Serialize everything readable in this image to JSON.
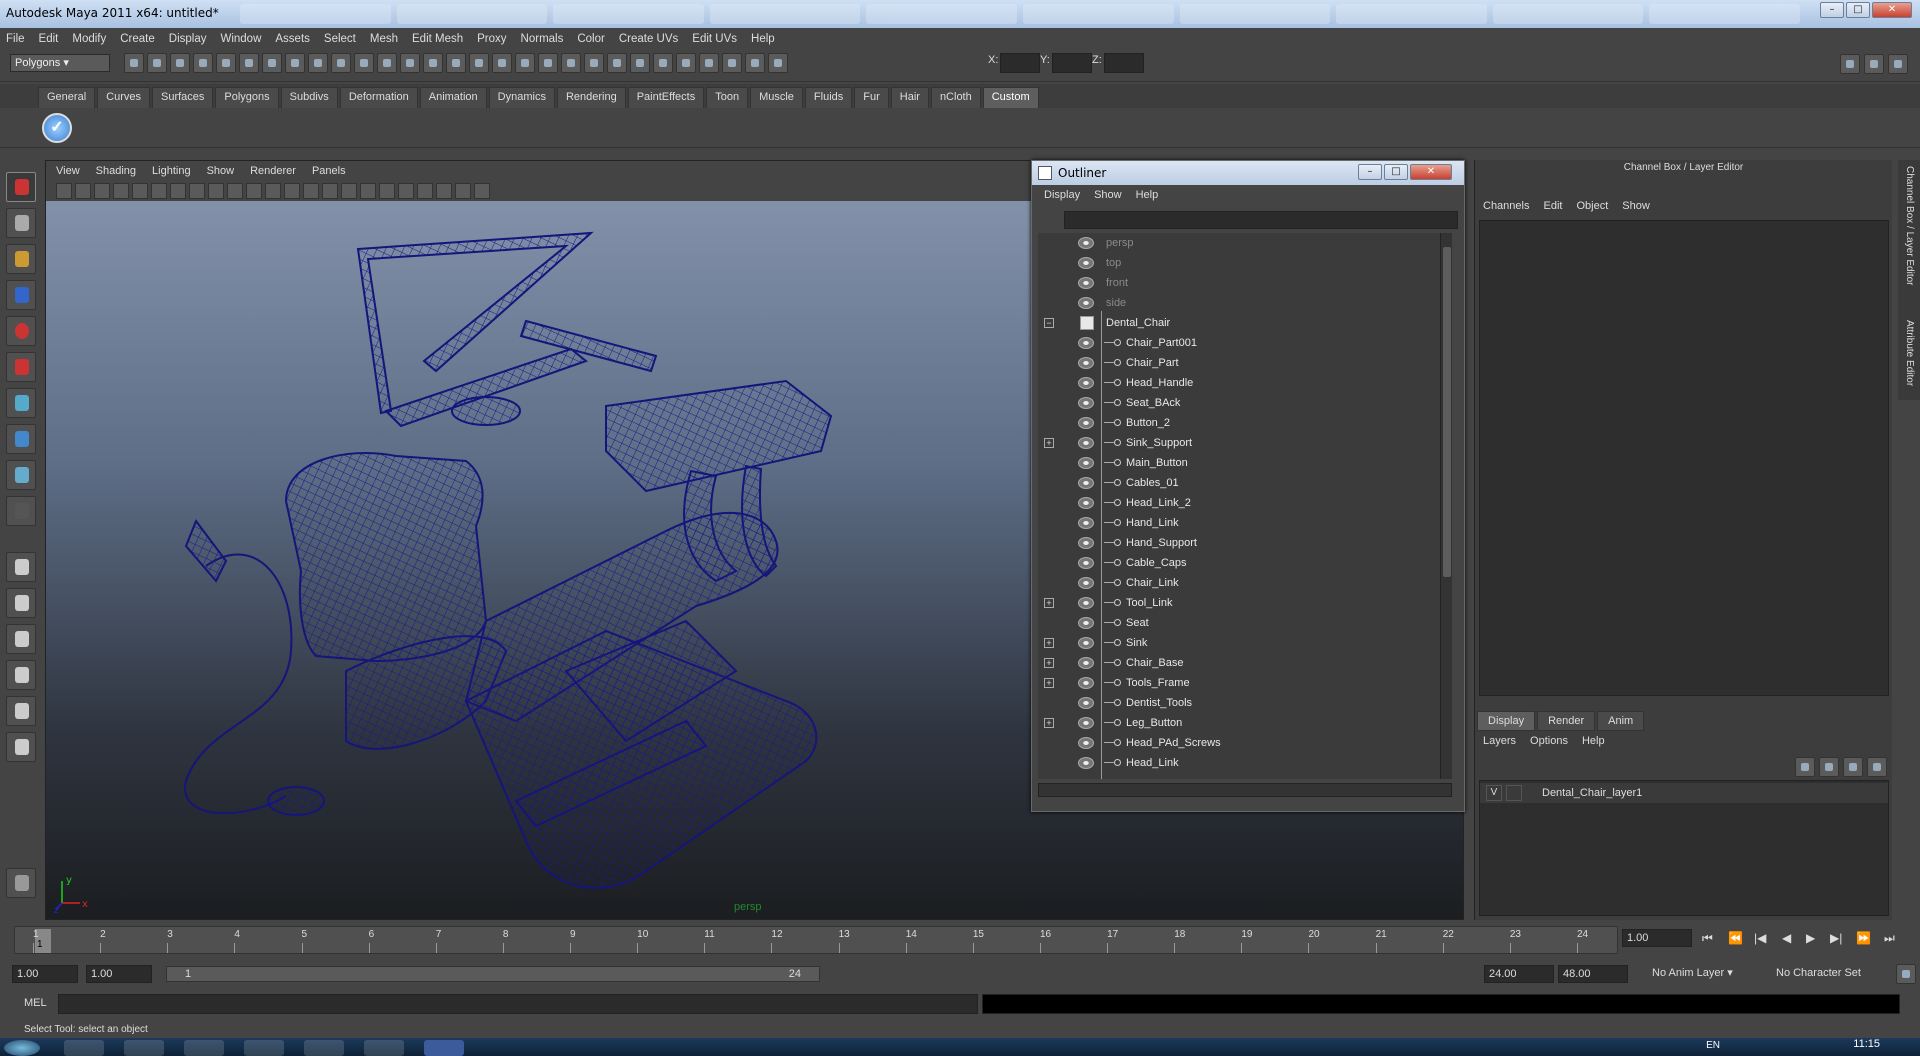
{
  "window": {
    "title": "Autodesk Maya 2011 x64: untitled*"
  },
  "menubar": [
    "File",
    "Edit",
    "Modify",
    "Create",
    "Display",
    "Window",
    "Assets",
    "Select",
    "Mesh",
    "Edit Mesh",
    "Proxy",
    "Normals",
    "Color",
    "Create UVs",
    "Edit UVs",
    "Help"
  ],
  "statusline": {
    "mode": "Polygons",
    "x_label": "X:",
    "y_label": "Y:",
    "z_label": "Z:"
  },
  "shelf_tabs": [
    "General",
    "Curves",
    "Surfaces",
    "Polygons",
    "Subdivs",
    "Deformation",
    "Animation",
    "Dynamics",
    "Rendering",
    "PaintEffects",
    "Toon",
    "Muscle",
    "Fluids",
    "Fur",
    "Hair",
    "nCloth",
    "Custom"
  ],
  "shelf_active_tab": "Custom",
  "viewport": {
    "menu": [
      "View",
      "Shading",
      "Lighting",
      "Show",
      "Renderer",
      "Panels"
    ],
    "camera_label": "persp",
    "axis_x": "x",
    "axis_y": "y",
    "axis_z": "z"
  },
  "outliner": {
    "title": "Outliner",
    "menu": [
      "Display",
      "Show",
      "Help"
    ],
    "cameras": [
      "persp",
      "top",
      "front",
      "side"
    ],
    "root": "Dental_Chair",
    "children": [
      {
        "name": "Chair_Part001",
        "expandable": false
      },
      {
        "name": "Chair_Part",
        "expandable": false
      },
      {
        "name": "Head_Handle",
        "expandable": false
      },
      {
        "name": "Seat_BAck",
        "expandable": false
      },
      {
        "name": "Button_2",
        "expandable": false
      },
      {
        "name": "Sink_Support",
        "expandable": true
      },
      {
        "name": "Main_Button",
        "expandable": false
      },
      {
        "name": "Cables_01",
        "expandable": false
      },
      {
        "name": "Head_Link_2",
        "expandable": false
      },
      {
        "name": "Hand_Link",
        "expandable": false
      },
      {
        "name": "Hand_Support",
        "expandable": false
      },
      {
        "name": "Cable_Caps",
        "expandable": false
      },
      {
        "name": "Chair_Link",
        "expandable": false
      },
      {
        "name": "Tool_Link",
        "expandable": true
      },
      {
        "name": "Seat",
        "expandable": false
      },
      {
        "name": "Sink",
        "expandable": true
      },
      {
        "name": "Chair_Base",
        "expandable": true
      },
      {
        "name": "Tools_Frame",
        "expandable": true
      },
      {
        "name": "Dentist_Tools",
        "expandable": false
      },
      {
        "name": "Leg_Button",
        "expandable": true
      },
      {
        "name": "Head_PAd_Screws",
        "expandable": false
      },
      {
        "name": "Head_Link",
        "expandable": false
      }
    ]
  },
  "channelbox": {
    "title": "Channel Box / Layer Editor",
    "menu": [
      "Channels",
      "Edit",
      "Object",
      "Show"
    ],
    "layer_tabs": [
      "Display",
      "Render",
      "Anim"
    ],
    "layer_active_tab": "Display",
    "layer_menu": [
      "Layers",
      "Options",
      "Help"
    ],
    "layer": {
      "visible": "V",
      "name": "Dental_Chair_layer1"
    }
  },
  "side_tabs": [
    "Channel Box / Layer Editor",
    "Attribute Editor"
  ],
  "timeslider": {
    "ticks": [
      "1",
      "2",
      "3",
      "4",
      "5",
      "6",
      "7",
      "8",
      "9",
      "10",
      "11",
      "12",
      "13",
      "14",
      "15",
      "16",
      "17",
      "18",
      "19",
      "20",
      "21",
      "22",
      "23",
      "24"
    ],
    "current_frame": "1",
    "current_time": "1.00"
  },
  "rangeslider": {
    "start": "1.00",
    "playback_start": "1.00",
    "range_start": "1",
    "range_end": "24",
    "playback_end": "24.00",
    "end": "48.00",
    "anim_layer": "No Anim Layer",
    "char_set": "No Character Set"
  },
  "cmdline": {
    "label": "MEL"
  },
  "helpline": "Select Tool: select an object",
  "taskbar": {
    "lang": "EN",
    "clock": "11:15"
  }
}
